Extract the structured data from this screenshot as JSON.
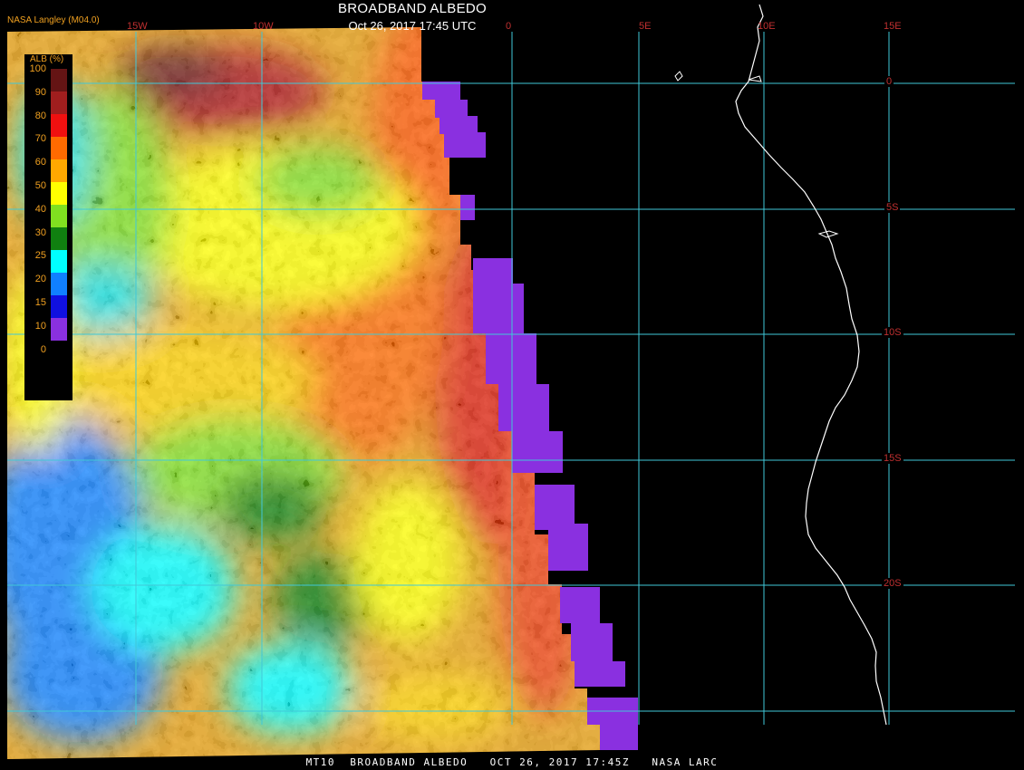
{
  "title": "BROADBAND ALBEDO",
  "datetime": "Oct 26, 2017 17:45 UTC",
  "source": "NASA Langley (M04.0)",
  "caption": "MT10  BROADBAND ALBEDO   OCT 26, 2017 17:45Z   NASA LARC",
  "legend": {
    "title": "ALB (%)",
    "ticks": [
      "100",
      "90",
      "80",
      "70",
      "60",
      "50",
      "40",
      "30",
      "25",
      "20",
      "15",
      "10",
      "0"
    ],
    "colors": [
      "#641414",
      "#a01e1e",
      "#f01010",
      "#ff6a00",
      "#ffa800",
      "#ffff00",
      "#80e020",
      "#108010",
      "#00ffff",
      "#1080ff",
      "#1010e0",
      "#8a30e0"
    ]
  },
  "map": {
    "longitude_labels": [
      "15W",
      "10W",
      "0",
      "5E",
      "10E",
      "15E"
    ],
    "latitude_labels": [
      "0",
      "5S",
      "10S",
      "15S",
      "20S"
    ],
    "grid_color": "#40c8d8",
    "label_color": "#c03030",
    "no_data_color": "#8a30e0"
  }
}
